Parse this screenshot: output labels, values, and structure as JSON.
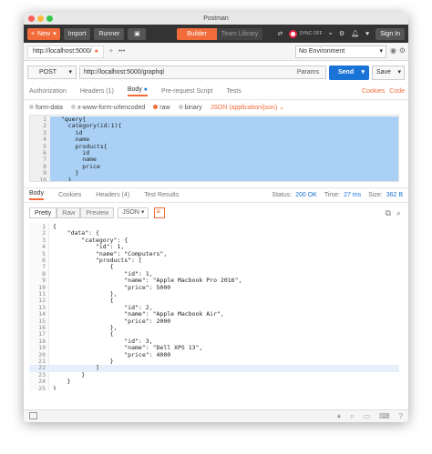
{
  "window": {
    "title": "Postman",
    "traffic_colors": [
      "#fc605c",
      "#fdbc40",
      "#34c84a"
    ]
  },
  "toolbar": {
    "new_label": "New",
    "import_label": "Import",
    "runner_label": "Runner",
    "builder_label": "Builder",
    "team_library_label": "Team Library",
    "sync_label": "SYNC OFF",
    "signin_label": "Sign In",
    "accent": "#f26b3a"
  },
  "tabs": {
    "active_tab": "http://localhost:5000/",
    "environment": "No Environment"
  },
  "request": {
    "method": "POST",
    "url": "http://localhost:5000/graphql",
    "params_label": "Params",
    "send_label": "Send",
    "save_label": "Save",
    "send_color": "#1a73d6"
  },
  "request_tabs": {
    "authorization": "Authorization",
    "headers": "Headers (1)",
    "body": "Body",
    "prerequest": "Pre-request Script",
    "tests": "Tests",
    "cookies_link": "Cookies",
    "code_link": "Code"
  },
  "body_types": {
    "form_data": "form-data",
    "urlencoded": "x-www-form-urlencoded",
    "raw": "raw",
    "binary": "binary",
    "content_type": "JSON (application/json)"
  },
  "request_body": [
    {
      "num": "1",
      "code": "  \"query{"
    },
    {
      "num": "2",
      "code": "    category(id:1){"
    },
    {
      "num": "3",
      "code": "      id"
    },
    {
      "num": "4",
      "code": "      name"
    },
    {
      "num": "5",
      "code": "      products{"
    },
    {
      "num": "6",
      "code": "        id"
    },
    {
      "num": "7",
      "code": "        name"
    },
    {
      "num": "8",
      "code": "        price"
    },
    {
      "num": "9",
      "code": "      }"
    },
    {
      "num": "10",
      "code": "    }"
    }
  ],
  "response_tabs": {
    "body": "Body",
    "cookies": "Cookies",
    "headers": "Headers (4)",
    "tests": "Test Results",
    "status_label": "Status:",
    "status_value": "200 OK",
    "time_label": "Time:",
    "time_value": "27 ms",
    "size_label": "Size:",
    "size_value": "362 B"
  },
  "view_modes": {
    "pretty": "Pretty",
    "raw": "Raw",
    "preview": "Preview",
    "format": "JSON"
  },
  "response_body": [
    {
      "num": "1",
      "code": "{",
      "str": false
    },
    {
      "num": "2",
      "code": "    \"data\": {",
      "str": false
    },
    {
      "num": "3",
      "code": "        \"category\": {",
      "str": false
    },
    {
      "num": "4",
      "code": "            \"id\": 1,",
      "str": false
    },
    {
      "num": "5",
      "code": "            \"name\": \"Computers\",",
      "str": false
    },
    {
      "num": "6",
      "code": "            \"products\": [",
      "str": false
    },
    {
      "num": "7",
      "code": "                {",
      "str": false
    },
    {
      "num": "8",
      "code": "                    \"id\": 1,",
      "str": false
    },
    {
      "num": "9",
      "code": "                    \"name\": \"Apple Macbook Pro 2016\",",
      "str": false
    },
    {
      "num": "10",
      "code": "                    \"price\": 5000",
      "str": false
    },
    {
      "num": "11",
      "code": "                },",
      "str": false
    },
    {
      "num": "12",
      "code": "                {",
      "str": false
    },
    {
      "num": "13",
      "code": "                    \"id\": 2,",
      "str": false
    },
    {
      "num": "14",
      "code": "                    \"name\": \"Apple Macbook Air\",",
      "str": false
    },
    {
      "num": "15",
      "code": "                    \"price\": 2000",
      "str": false
    },
    {
      "num": "16",
      "code": "                },",
      "str": false
    },
    {
      "num": "17",
      "code": "                {",
      "str": false
    },
    {
      "num": "18",
      "code": "                    \"id\": 3,",
      "str": false
    },
    {
      "num": "19",
      "code": "                    \"name\": \"Dell XPS 13\",",
      "str": false
    },
    {
      "num": "20",
      "code": "                    \"price\": 4000",
      "str": false
    },
    {
      "num": "21",
      "code": "                }",
      "str": false
    },
    {
      "num": "22",
      "code": "            ]",
      "str": false
    },
    {
      "num": "23",
      "code": "        }",
      "str": false
    },
    {
      "num": "24",
      "code": "    }",
      "str": false
    },
    {
      "num": "25",
      "code": "}",
      "str": false
    }
  ]
}
